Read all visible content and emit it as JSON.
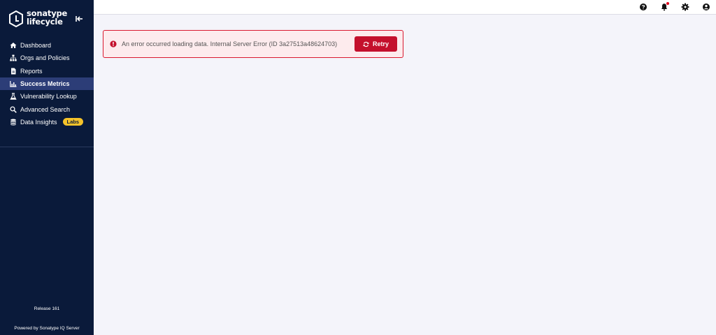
{
  "brand": {
    "line1": "sonatype",
    "line2": "lifecycle"
  },
  "nav": [
    {
      "label": "Dashboard",
      "icon": "home-icon"
    },
    {
      "label": "Orgs and Policies",
      "icon": "hierarchy-icon"
    },
    {
      "label": "Reports",
      "icon": "file-icon"
    },
    {
      "label": "Success Metrics",
      "icon": "chart-icon",
      "active": true
    },
    {
      "label": "Vulnerability Lookup",
      "icon": "vulnerability-icon"
    },
    {
      "label": "Advanced Search",
      "icon": "search-icon"
    },
    {
      "label": "Data Insights",
      "icon": "database-icon",
      "badge": "Labs"
    }
  ],
  "footer": {
    "release": "Release 161",
    "powered": "Powered by Sonatype IQ Server"
  },
  "error": {
    "message": "An error occurred loading data. Internal Server Error (ID 3a27513a48624703)",
    "retry_label": "Retry"
  },
  "colors": {
    "sidebar": "#0a1a3a",
    "active": "#2c3d77",
    "error": "#c4102c",
    "badge": "#f5c32a"
  }
}
